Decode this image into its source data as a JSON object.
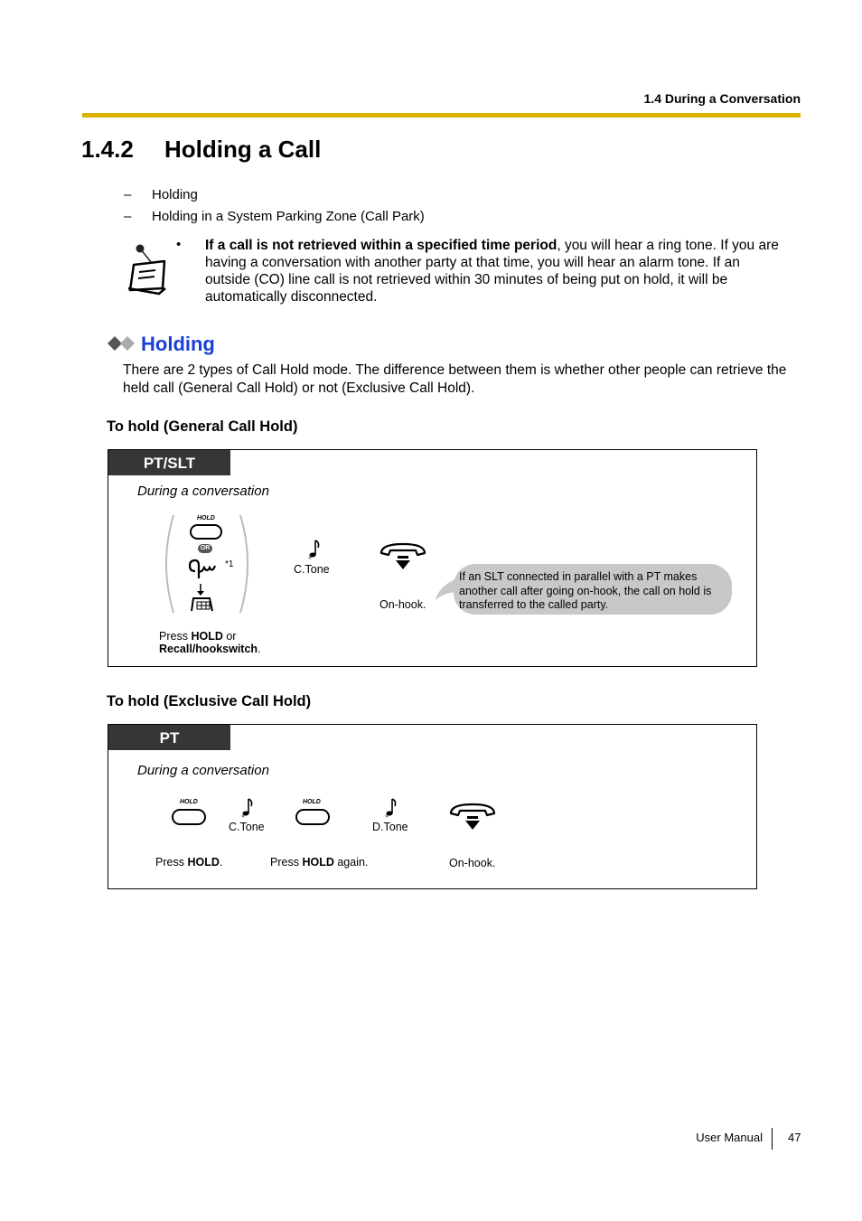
{
  "header": {
    "section": "1.4 During a Conversation"
  },
  "title": {
    "number": "1.4.2",
    "text": "Holding a Call"
  },
  "topics": [
    {
      "dash": "–",
      "label": "Holding"
    },
    {
      "dash": "–",
      "label": "Holding in a System Parking Zone (Call Park)"
    }
  ],
  "note": {
    "icon": "note-pin-icon",
    "bullet": "•",
    "bold": "If a call is not retrieved within a specified time period",
    "text": ", you will hear a ring tone. If you are having a conversation with another party at that time, you will hear an alarm tone. If an outside (CO) line call is not retrieved within 30 minutes of being put on hold, it will be automatically disconnected."
  },
  "section": {
    "icon": "double-diamond-icon",
    "title": "Holding",
    "title_color": "#1a3fd6",
    "paragraph": "There are 2 types of Call Hold mode. The difference between them is whether other people can retrieve the held call (General Call Hold) or not (Exclusive Call Hold)."
  },
  "general_hold": {
    "heading": "To hold (General Call Hold)",
    "tab": "PT/SLT",
    "context": "During a conversation",
    "hold_key_label": "HOLD",
    "or_label": "OR",
    "footnote_mark": "*1",
    "step1_prefix": "Press ",
    "step1_bold1": "HOLD",
    "step1_mid": " or",
    "step1_bold2": "Recall/hookswitch",
    "step1_suffix": ".",
    "tone_label": "C.Tone",
    "onhook_label": "On-hook.",
    "bubble_text": "If an SLT connected in parallel with a PT makes another call after going on-hook, the call on hold is transferred to the called party."
  },
  "exclusive_hold": {
    "heading": "To hold (Exclusive Call Hold)",
    "tab": "PT",
    "context": "During a conversation",
    "hold_key_label": "HOLD",
    "tone1_label": "C.Tone",
    "tone2_label": "D.Tone",
    "step1_prefix": "Press ",
    "step1_bold": "HOLD",
    "step1_suffix": ".",
    "step2_prefix": "Press ",
    "step2_bold": "HOLD",
    "step2_suffix": " again.",
    "onhook_label": "On-hook."
  },
  "footer": {
    "label": "User Manual",
    "page": "47"
  },
  "colors": {
    "header_rule": "#d9b300",
    "tab_bg": "#363636",
    "bubble_bg": "#c8c8c8"
  }
}
